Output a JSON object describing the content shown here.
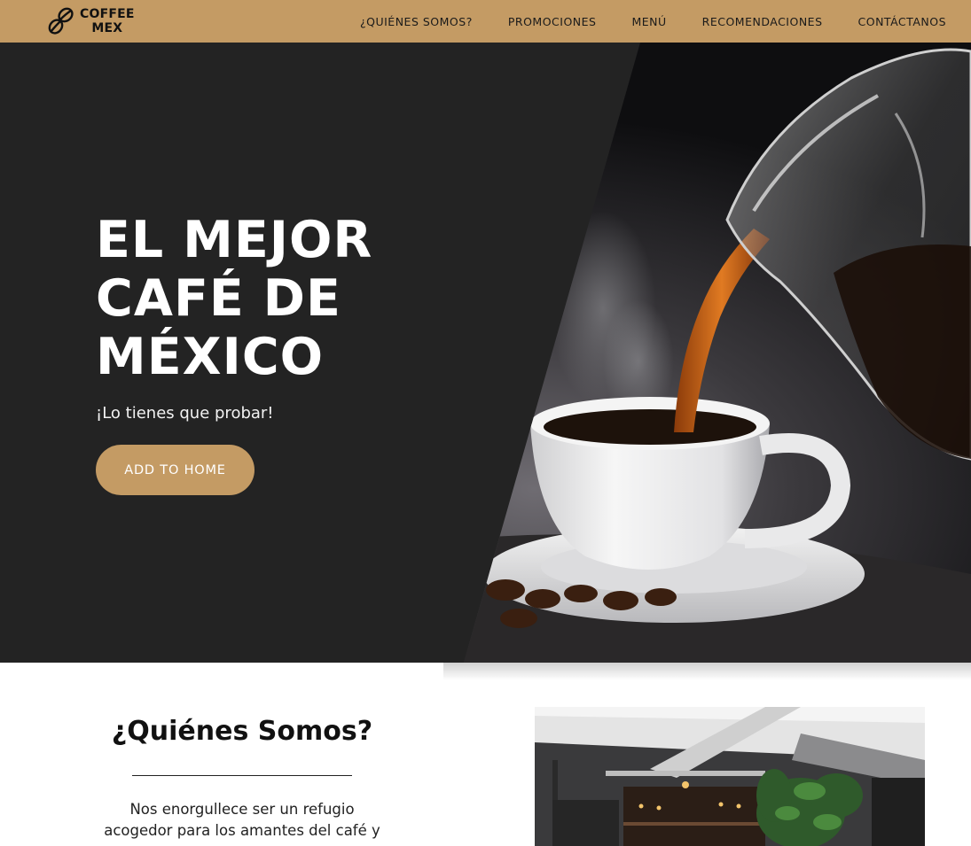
{
  "navbar": {
    "brand_line1": "COFFEE",
    "brand_line2": "MEX",
    "logo_icon": "coffee-beans-icon",
    "background_color": "#c49b64",
    "links": [
      "¿QUIÉNES SOMOS?",
      "PROMOCIONES",
      "MENÚ",
      "RECOMENDACIONES",
      "CONTÁCTANOS"
    ]
  },
  "hero": {
    "title_line1": "EL MEJOR",
    "title_line2": "CAFÉ DE",
    "title_line3": "MÉXICO",
    "subtitle": "¡Lo tienes que probar!",
    "button_label": "ADD TO HOME",
    "background_color": "#232323",
    "image": "coffee-pouring-into-cup-photo"
  },
  "about": {
    "title": "¿Quiénes Somos?",
    "text": "Nos enorgullece ser un refugio acogedor para los amantes del café y",
    "image": "cafe-interior-photo"
  },
  "colors": {
    "accent": "#c49b64",
    "dark": "#232323"
  }
}
